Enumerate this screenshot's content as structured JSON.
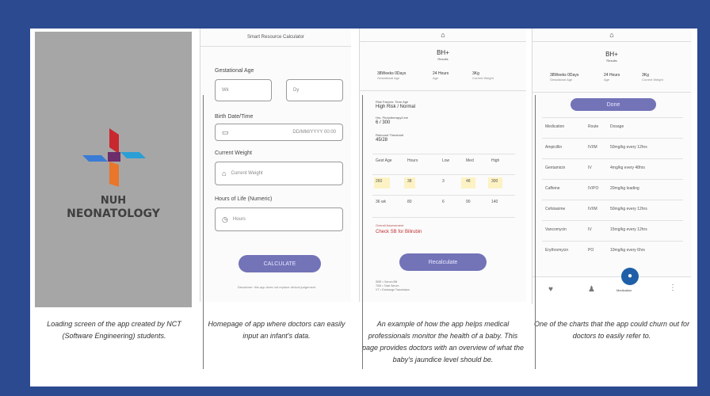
{
  "panel1": {
    "logo_line1": "NUH",
    "logo_line2": "NEONATOLOGY",
    "caption": "Loading screen of the app created by NCT (Software Engineering) students."
  },
  "panel2": {
    "title": "Smart Resource Calculator",
    "gestational_age_label": "Gestational Age",
    "weeks_placeholder": "Wk",
    "days_placeholder": "Dy",
    "birth_date_label": "Birth Date/Time",
    "birth_date_value": "DD/MM/YYYY 00:00",
    "current_weight_label": "Current Weight",
    "current_weight_placeholder": "Current Weight",
    "hours_of_life_label": "Hours of Life (Numeric)",
    "hours_placeholder": "Hours",
    "calculate_button": "CALCULATE",
    "footer_note": "Disclaimer: this app does not replace clinical judgement",
    "caption": "Homepage of app where doctors can easily input an infant's data."
  },
  "panel3": {
    "top_title": "BH+",
    "top_sub": "Results",
    "stats": [
      {
        "value": "38Weeks 0Days",
        "label": "Gestational Age"
      },
      {
        "value": "24 Hours",
        "label": "Age"
      },
      {
        "value": "3Kg",
        "label": "Current Weight"
      }
    ],
    "risk_label": "Risk Factors: Term Age",
    "risk_value": "High Risk / Normal",
    "photo_label": "Hrs. Phototherapy/Line",
    "photo_value": "6 / 300",
    "rebound_label": "Rebound Threshold",
    "rebound_value": "45/28",
    "table_headers": [
      "Gest Age",
      "Hours",
      "Low",
      "Med",
      "High"
    ],
    "table_row1": [
      "260",
      "38",
      "3",
      "48",
      "300"
    ],
    "table_row2": [
      "36 wk",
      "80",
      "6",
      "90",
      "140"
    ],
    "recommend_label": "Overall Assessment",
    "recommend_value": "Check SB for Bilirubin",
    "button": "Recalculate",
    "legend": [
      "SBR = Serum Bili",
      "TSB = Total Serum",
      "VT = Exchange Transfusion"
    ],
    "caption": "An example of how the app helps medical professionals monitor the health of a baby. This page provides doctors with an overview of what the baby's jaundice level should be."
  },
  "panel4": {
    "top_title": "BH+",
    "top_sub": "Results",
    "stats": [
      {
        "value": "38Weeks 0Days",
        "label": "Gestational Age"
      },
      {
        "value": "24 Hours",
        "label": "Age"
      },
      {
        "value": "3Kg",
        "label": "Current Weight"
      }
    ],
    "button": "Done",
    "table_headers": [
      "Medication",
      "Route",
      "Dosage"
    ],
    "rows": [
      [
        "Ampicillin",
        "IV/IM",
        "50mg/kg every 12hrs"
      ],
      [
        "Gentamicin",
        "IV",
        "4mg/kg every 48hrs"
      ],
      [
        "Caffeine",
        "IV/PO",
        "20mg/kg loading"
      ],
      [
        "Cefotaxime",
        "IV/IM",
        "50mg/kg every 12hrs"
      ],
      [
        "Vancomycin",
        "IV",
        "15mg/kg every 12hrs"
      ],
      [
        "Erythromycin",
        "PO",
        "10mg/kg every 6hrs"
      ]
    ],
    "nav_labels": [
      "",
      "",
      "Medication",
      ""
    ],
    "caption": "One of the charts that the app could churn out for doctors to easily refer to."
  }
}
